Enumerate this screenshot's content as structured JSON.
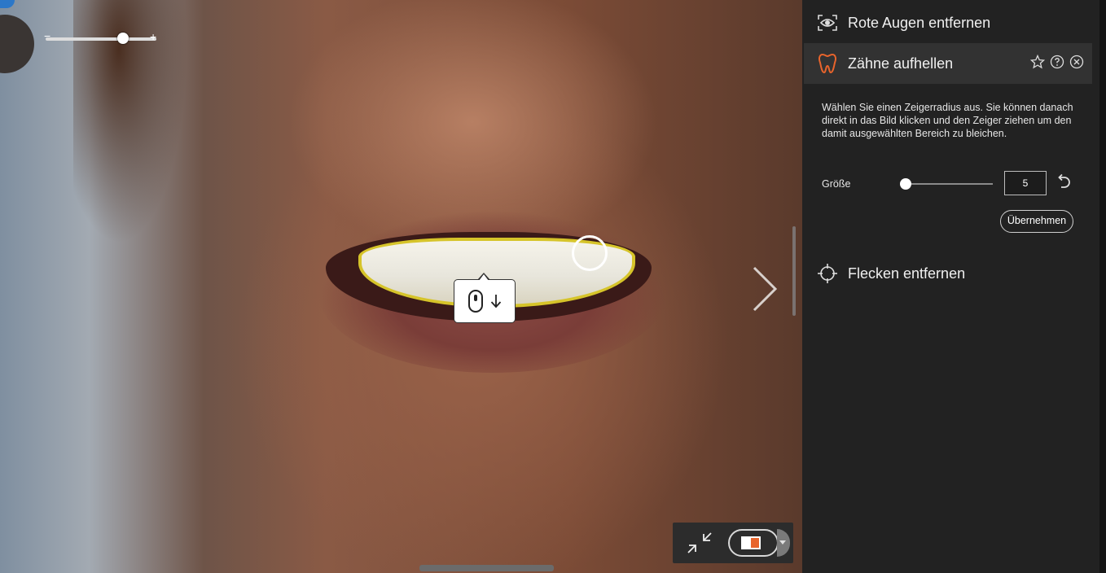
{
  "canvas": {
    "tooltip": {
      "mouse_icon": "mouse-icon",
      "arrow_icon": "arrow-down-icon"
    },
    "zoom": {
      "minus_label": "−",
      "plus_label": "+",
      "level": 0.68
    }
  },
  "panel": {
    "red_eye": {
      "label": "Rote Augen entfernen",
      "icon": "red-eye-icon"
    },
    "teeth": {
      "label": "Zähne aufhellen",
      "icon": "tooth-icon",
      "description": "Wählen Sie einen Zeigerradius aus. Sie können danach direkt in das Bild klicken und den Zeiger ziehen um den damit ausgewählten Bereich zu bleichen.",
      "size_label": "Größe",
      "size_value": "5",
      "apply_label": "Übernehmen"
    },
    "spots": {
      "label": "Flecken entfernen",
      "icon": "crosshair-icon"
    }
  },
  "colors": {
    "accent": "#e8642c",
    "panel_bg": "#222222",
    "highlight_row": "#323232",
    "teeth_outline": "#d6c42a"
  }
}
